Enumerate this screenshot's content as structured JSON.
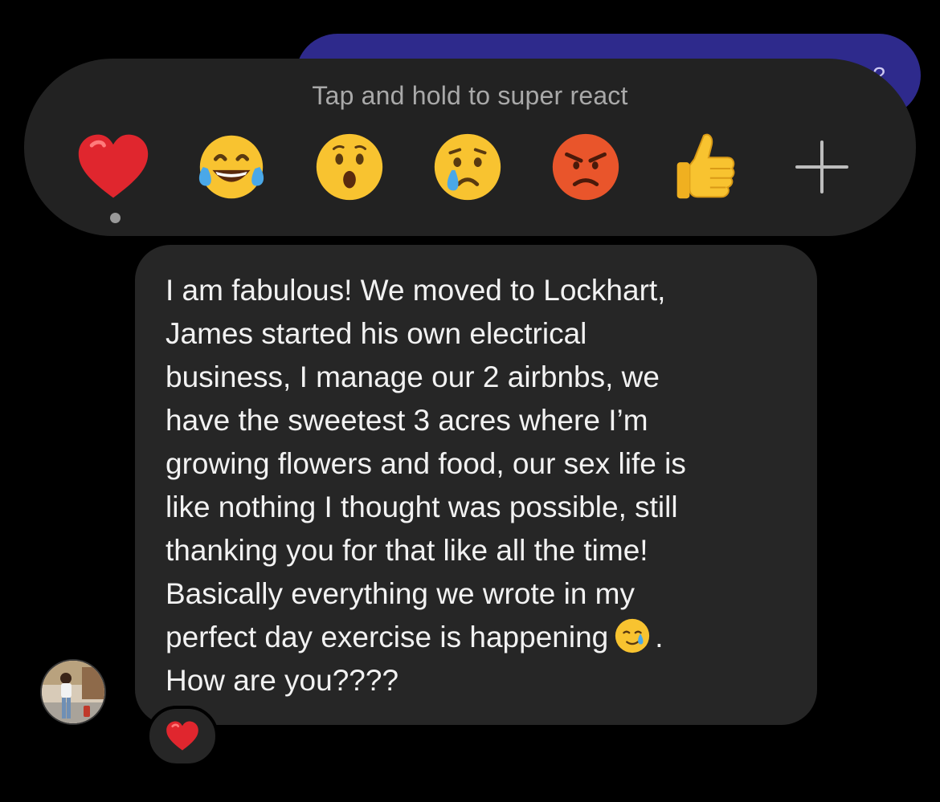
{
  "conversation": {
    "sent_message_peek": "?"
  },
  "reaction_picker": {
    "hint": "Tap and hold to super react",
    "reactions": [
      {
        "name": "heart",
        "selected": true
      },
      {
        "name": "tears-of-joy",
        "selected": false
      },
      {
        "name": "surprised",
        "selected": false
      },
      {
        "name": "crying",
        "selected": false
      },
      {
        "name": "angry",
        "selected": false
      },
      {
        "name": "thumbs-up",
        "selected": false
      }
    ],
    "more_icon": "plus-icon"
  },
  "message": {
    "text_before_emoji": "I am fabulous! We moved to Lockhart,\nJames started his own electrical\nbusiness, I manage our 2 airbnbs, we\nhave the sweetest 3 acres where I’m\ngrowing flowers and food, our sex life is\nlike nothing I thought was possible, still\nthanking you for that like all the time!\nBasically everything we wrote in my\nperfect day exercise is happening",
    "inline_emoji": "smiling-face-with-tear",
    "text_after_emoji": ".\nHow are you????",
    "reaction_badge": "heart"
  },
  "colors": {
    "background": "#000000",
    "reaction_bar": "#222222",
    "bubble": "#262626",
    "sent_bubble": "#2e2a8c",
    "heart": "#e0262e"
  }
}
